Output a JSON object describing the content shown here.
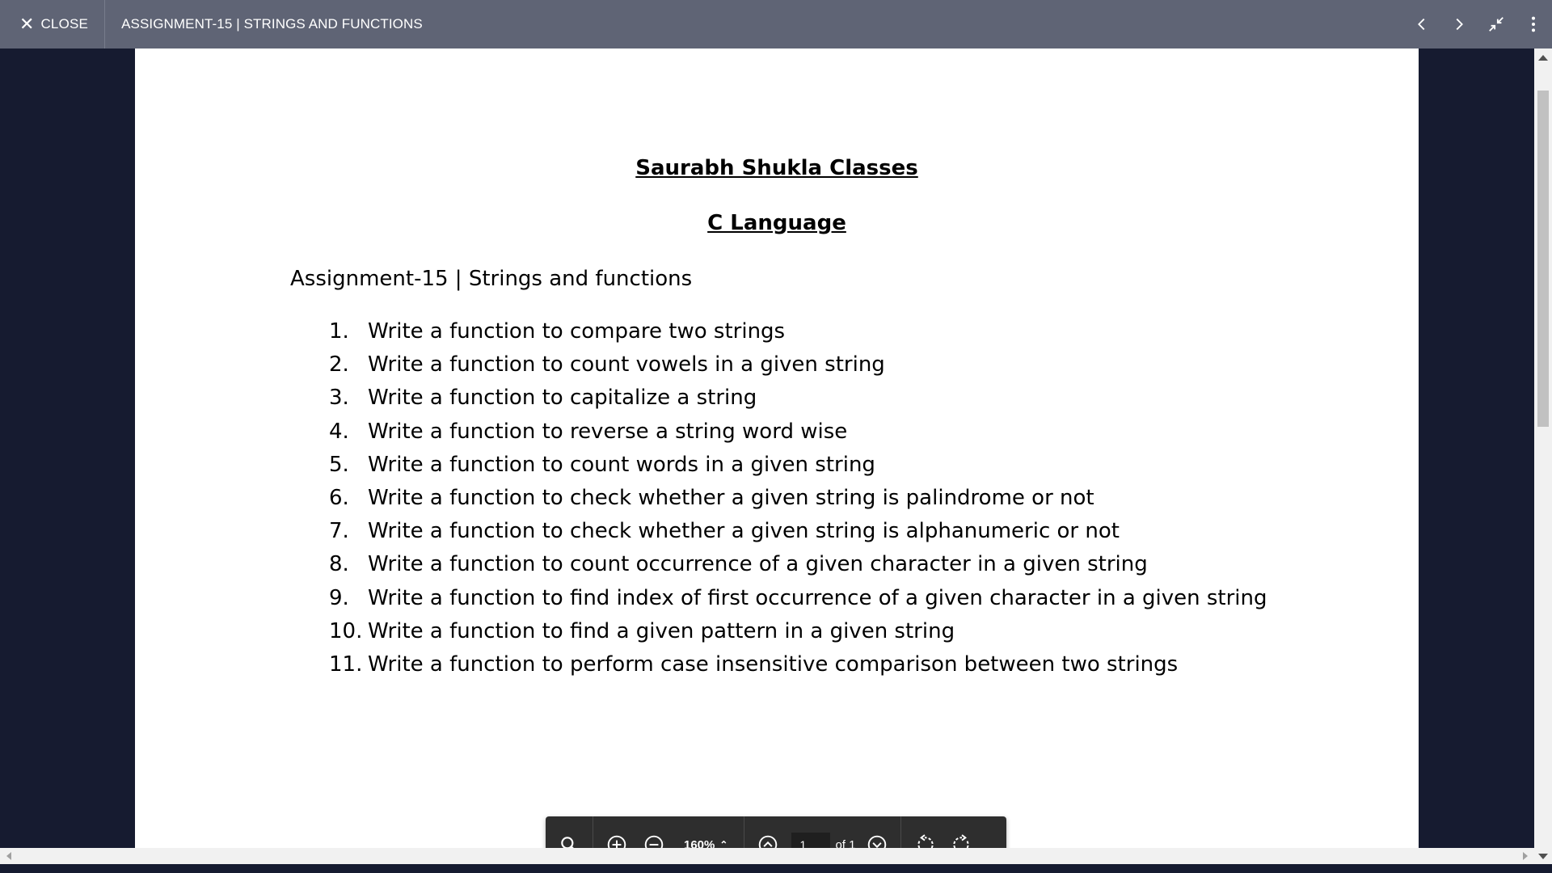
{
  "topbar": {
    "close_label": "CLOSE",
    "doc_title": "ASSIGNMENT-15 | STRINGS AND FUNCTIONS"
  },
  "document": {
    "heading": "Saurabh Shukla Classes",
    "subheading": "C Language",
    "subtitle": "Assignment-15 | Strings and functions",
    "items": [
      {
        "num": "1.",
        "text": "Write a function to compare two strings"
      },
      {
        "num": "2.",
        "text": "Write a function to count vowels in a given string"
      },
      {
        "num": "3.",
        "text": "Write a function to capitalize a string"
      },
      {
        "num": "4.",
        "text": "Write a function to reverse a string word wise"
      },
      {
        "num": "5.",
        "text": "Write a function to count words in a given string"
      },
      {
        "num": "6.",
        "text": "Write a function to check whether a given string is palindrome or not"
      },
      {
        "num": "7.",
        "text": "Write a function to check whether a given string is alphanumeric or not"
      },
      {
        "num": "8.",
        "text": "Write a function to count occurrence of a given character in a given string"
      },
      {
        "num": "9.",
        "text": "Write a function to find index of first occurrence of a given character in a given string"
      },
      {
        "num": "10.",
        "text": "Write a function to find a given pattern in a given string"
      },
      {
        "num": "11.",
        "text": "Write a function to perform case insensitive comparison between two strings"
      }
    ]
  },
  "toolbar": {
    "zoom": "160%",
    "page_current": "1",
    "page_total": "of 1"
  }
}
